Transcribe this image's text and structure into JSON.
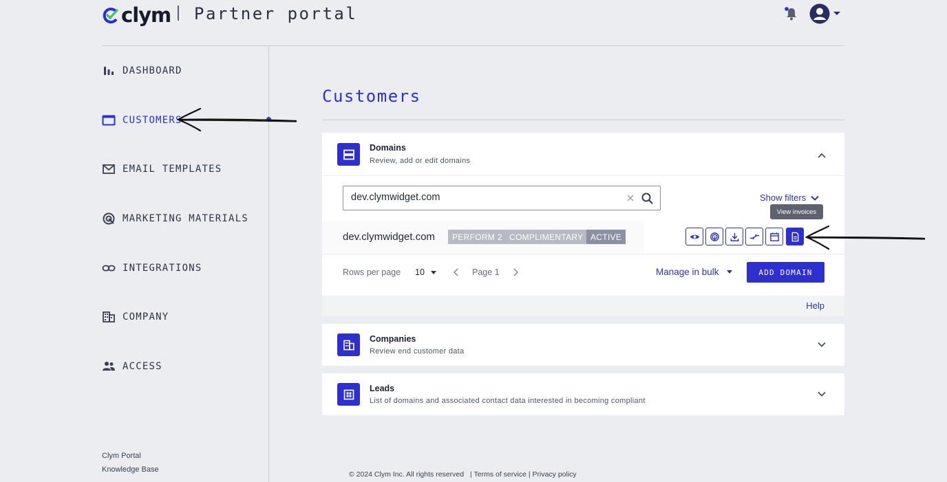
{
  "header": {
    "logo_text": "clym",
    "portal_title": "Partner portal"
  },
  "sidebar": {
    "items": [
      {
        "label": "DASHBOARD",
        "icon": "bar-chart-icon"
      },
      {
        "label": "CUSTOMERS",
        "icon": "folder-icon",
        "active": true
      },
      {
        "label": "EMAIL TEMPLATES",
        "icon": "envelope-icon"
      },
      {
        "label": "MARKETING MATERIALS",
        "icon": "target-icon"
      },
      {
        "label": "INTEGRATIONS",
        "icon": "link-icon"
      },
      {
        "label": "COMPANY",
        "icon": "building-icon"
      },
      {
        "label": "ACCESS",
        "icon": "people-icon"
      }
    ],
    "footer_links": [
      "Clym Portal",
      "Knowledge Base"
    ]
  },
  "main": {
    "title": "Customers",
    "domains": {
      "title": "Domains",
      "subtitle": "Review, add or edit domains",
      "search_value": "dev.clymwidget.com",
      "show_filters": "Show filters",
      "tooltip": "View invoices",
      "row": {
        "domain": "dev.clymwidget.com",
        "tags": [
          "PERFORM 2",
          "COMPLIMENTARY",
          "ACTIVE"
        ]
      },
      "actions": [
        "eye-icon",
        "fingerprint-icon",
        "download-icon",
        "compare-icon",
        "calendar-icon",
        "invoice-icon"
      ],
      "rows_per_page_label": "Rows per page",
      "rows_per_page_value": "10",
      "page_label": "Page 1",
      "manage_bulk": "Manage in bulk",
      "add_domain": "ADD DOMAIN",
      "help": "Help"
    },
    "companies": {
      "title": "Companies",
      "subtitle": "Review end customer data"
    },
    "leads": {
      "title": "Leads",
      "subtitle": "List of domains and associated contact data interested in becoming compliant"
    }
  },
  "footer": {
    "copyright": "© 2024 Clym Inc. All rights reserved",
    "terms": "Terms of service",
    "privacy": "Privacy policy",
    "separator": "|"
  },
  "colors": {
    "accent": "#2e2fcf",
    "background": "#ebedf0",
    "tag_gray": "#b7bac3"
  }
}
